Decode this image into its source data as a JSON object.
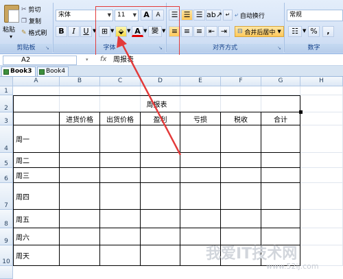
{
  "ribbon": {
    "clipboard": {
      "paste": "粘贴",
      "cut": "剪切",
      "copy": "复制",
      "format_painter": "格式刷",
      "caption": "剪贴板"
    },
    "font": {
      "name": "宋体",
      "size": "11",
      "grow": "A",
      "shrink": "A",
      "bold": "B",
      "italic": "I",
      "underline": "U",
      "font_color": "A",
      "phonetic": "變",
      "caption": "字体"
    },
    "alignment": {
      "wrap_text": "自动换行",
      "merge_center": "合并后居中",
      "caption": "对齐方式"
    },
    "number": {
      "format": "常规",
      "percent": "%",
      "comma": ",",
      "caption": "数字"
    }
  },
  "formula_bar": {
    "name_box": "A2",
    "fx": "fx",
    "content": "周报表"
  },
  "tabs": [
    {
      "label": "Book3 *",
      "active": true
    },
    {
      "label": "Book4",
      "active": false
    }
  ],
  "columns": [
    "A",
    "B",
    "C",
    "D",
    "E",
    "F",
    "G",
    "H"
  ],
  "rows": [
    "1",
    "2",
    "3",
    "4",
    "5",
    "6",
    "7",
    "8",
    "9",
    "10"
  ],
  "sheet": {
    "title": "周报表",
    "headers": [
      "进货价格",
      "出货价格",
      "盈利",
      "亏损",
      "税收",
      "合计"
    ],
    "days": [
      "周一",
      "周二",
      "周三",
      "周四",
      "周五",
      "周六",
      "周天"
    ]
  },
  "watermark": {
    "main": "我爱IT技术网",
    "sub": "www.52ij.com"
  },
  "colors": {
    "annotation": "#e33a3a",
    "ribbon_caption": "#15428b"
  }
}
